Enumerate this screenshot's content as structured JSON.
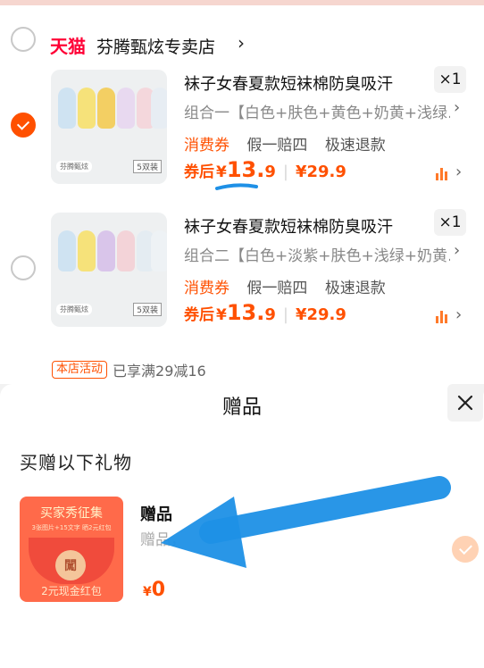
{
  "shop": {
    "logo_text": "天猫",
    "name": "芬腾甄炫专卖店",
    "chevron": "›"
  },
  "items": [
    {
      "selected": true,
      "title": "袜子女春夏款短袜棉防臭吸汗",
      "quantity": "×1",
      "variant": "组合一【白色+肤色+黄色+奶黄+浅绿…",
      "tags": [
        "消费券",
        "假一赔四",
        "极速退款"
      ],
      "price_label": "券后",
      "price_symbol": "¥",
      "price_int": "13.",
      "price_dec": "9",
      "original_price": "¥29.9",
      "thumb_brand": "芬腾甄炫",
      "thumb_pack": "5双装",
      "sock_colors": [
        "#cfe3f2",
        "#f6e27a",
        "#f3cf63",
        "#e8d9f0",
        "#f4d7dc",
        "#e7edf3"
      ]
    },
    {
      "selected": false,
      "title": "袜子女春夏款短袜棉防臭吸汗",
      "quantity": "×1",
      "variant": "组合二【白色+淡紫+肤色+浅绿+奶黄…",
      "tags": [
        "消费券",
        "假一赔四",
        "极速退款"
      ],
      "price_label": "券后",
      "price_symbol": "¥",
      "price_int": "13.",
      "price_dec": "9",
      "original_price": "¥29.9",
      "thumb_brand": "芬腾甄炫",
      "thumb_pack": "5双装",
      "sock_colors": [
        "#cfe3f2",
        "#f6e27a",
        "#d9c5ea",
        "#f3d3d8",
        "#e4ecf2",
        "#eef2f5"
      ]
    }
  ],
  "promo": {
    "badge": "本店活动",
    "text": "已享满29减16"
  },
  "gift_sheet": {
    "title": "赠品",
    "close_icon": "close-icon",
    "section_heading": "买赠以下礼物",
    "gift": {
      "image_title": "买家秀征集",
      "image_sub": "3张图片+15文字 晒2元红包",
      "image_coin": "闖",
      "image_footer": "2元现金红包",
      "name": "赠品",
      "desc": "赠品，",
      "price_symbol": "¥",
      "price": "0",
      "selected": true
    }
  },
  "colors": {
    "accent": "#ff5000",
    "tmall_red": "#ff0036",
    "annotation_blue": "#1e90e6"
  }
}
